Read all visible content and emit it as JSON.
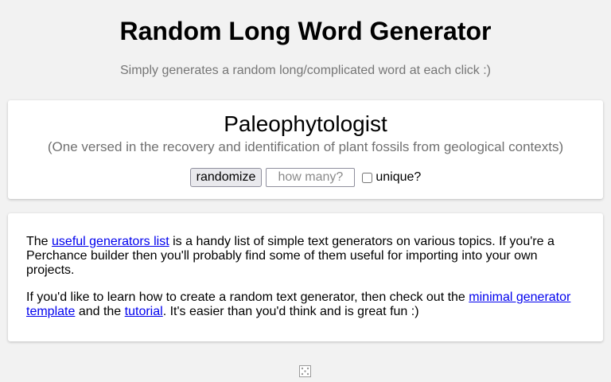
{
  "header": {
    "title": "Random Long Word Generator",
    "subtitle": "Simply generates a random long/complicated word at each click :)"
  },
  "output": {
    "word": "Paleophytologist",
    "definition": "(One versed in the recovery and identification of plant fossils from geological contexts)"
  },
  "controls": {
    "randomize_label": "randomize",
    "count_placeholder": "how many?",
    "count_value": "",
    "unique_label": "unique?",
    "unique_checked": false
  },
  "info": {
    "p1_prefix": "The ",
    "p1_link": "useful generators list",
    "p1_suffix": " is a handy list of simple text generators on various topics. If you're a Perchance builder then you'll probably find some of them useful for importing into your own projects.",
    "p2_prefix": "If you'd like to learn how to create a random text generator, then check out the ",
    "p2_link1": "minimal generator template",
    "p2_middle": " and the ",
    "p2_link2": "tutorial",
    "p2_suffix": ". It's easier than you'd think and is great fun :)"
  },
  "footer": {
    "icon": "dice-icon"
  },
  "colors": {
    "background": "#f2f2f2",
    "card": "#ffffff",
    "link": "#0000ee",
    "muted_text": "#767676"
  }
}
